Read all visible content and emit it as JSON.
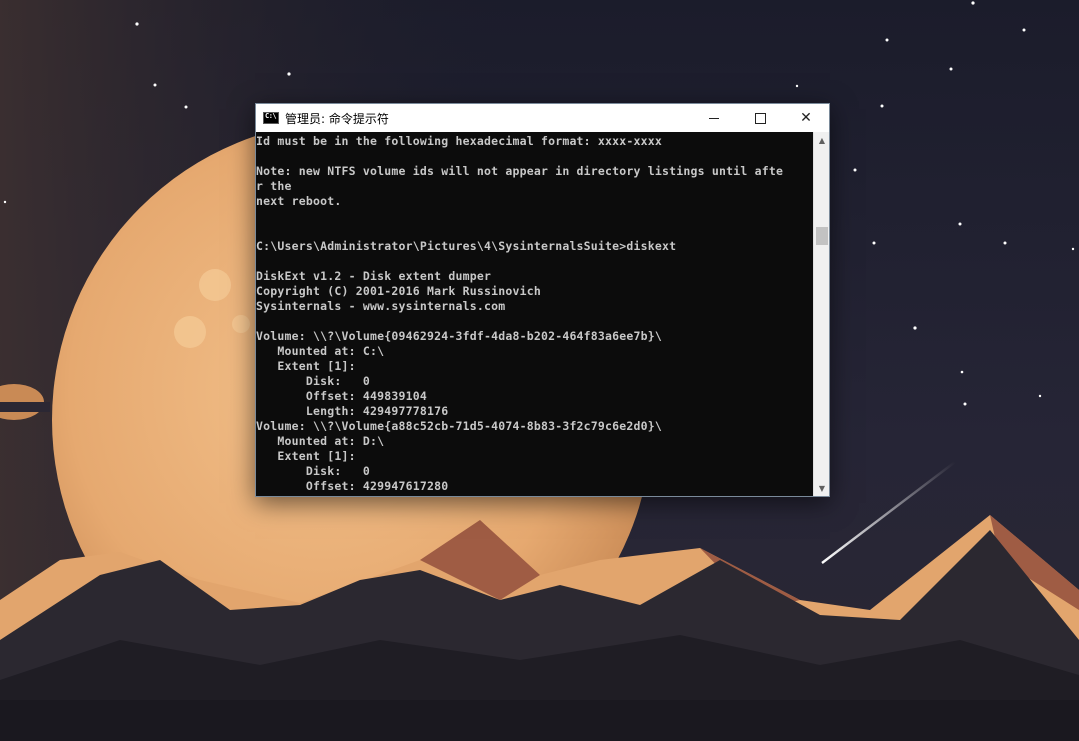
{
  "window": {
    "title": "管理员: 命令提示符",
    "app_icon_text": "C:\\",
    "controls": {
      "minimize_icon": "minimize-icon",
      "maximize_icon": "maximize-icon",
      "close_glyph": "✕"
    }
  },
  "console": {
    "lines": [
      "Id must be in the following hexadecimal format: xxxx-xxxx",
      "",
      "Note: new NTFS volume ids will not appear in directory listings until afte",
      "r the",
      "next reboot.",
      "",
      "",
      "C:\\Users\\Administrator\\Pictures\\4\\SysinternalsSuite>diskext",
      "",
      "DiskExt v1.2 - Disk extent dumper",
      "Copyright (C) 2001-2016 Mark Russinovich",
      "Sysinternals - www.sysinternals.com",
      "",
      "Volume: \\\\?\\Volume{09462924-3fdf-4da8-b202-464f83a6ee7b}\\",
      "   Mounted at: C:\\",
      "   Extent [1]:",
      "       Disk:   0",
      "       Offset: 449839104",
      "       Length: 429497778176",
      "Volume: \\\\?\\Volume{a88c52cb-71d5-4074-8b83-3f2c79c6e2d0}\\",
      "   Mounted at: D:\\",
      "   Extent [1]:",
      "       Disk:   0",
      "       Offset: 429947617280"
    ]
  },
  "scrollbar": {
    "up_glyph": "▲",
    "down_glyph": "▼",
    "position": 0.25
  },
  "colors": {
    "console_bg": "#0c0c0c",
    "console_text": "#c8c8c8",
    "sky": "#1c1d2b",
    "planet": "#e8b07c",
    "mountain_light": "#e4a872",
    "mountain_dark": "#2b2830"
  }
}
